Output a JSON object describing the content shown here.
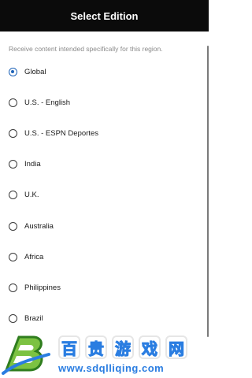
{
  "header": {
    "title": "Select Edition"
  },
  "subtitle": "Receive content intended specifically for this region.",
  "editions": [
    {
      "label": "Global",
      "selected": true
    },
    {
      "label": "U.S. - English",
      "selected": false
    },
    {
      "label": "U.S. - ESPN Deportes",
      "selected": false
    },
    {
      "label": "India",
      "selected": false
    },
    {
      "label": "U.K.",
      "selected": false
    },
    {
      "label": "Australia",
      "selected": false
    },
    {
      "label": "Africa",
      "selected": false
    },
    {
      "label": "Philippines",
      "selected": false
    },
    {
      "label": "Brazil",
      "selected": false
    }
  ],
  "watermark": {
    "chars": [
      "百",
      "贵",
      "游",
      "戏",
      "网"
    ],
    "url": "www.sdqlliqing.com"
  },
  "colors": {
    "header_bg": "#0b0b0b",
    "accent": "#1e63b8",
    "watermark": "#2a7de1"
  }
}
